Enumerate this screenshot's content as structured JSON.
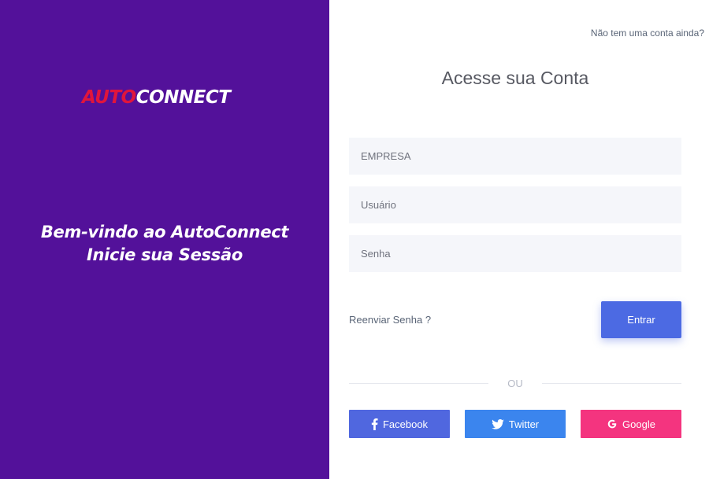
{
  "brand": {
    "logo_part1": "AUTO",
    "logo_part2": "CONNECT"
  },
  "welcome": {
    "line1": "Bem-vindo ao AutoConnect",
    "line2": "Inicie sua Sessão"
  },
  "header": {
    "signup_link": "Não tem uma conta ainda?"
  },
  "form": {
    "title": "Acesse sua Conta",
    "company_placeholder": "EMPRESA",
    "user_placeholder": "Usuário",
    "password_placeholder": "Senha",
    "company_value": "",
    "user_value": "",
    "password_value": "",
    "resend_password": "Reenviar Senha ?",
    "submit_label": "Entrar"
  },
  "divider": {
    "label": "OU"
  },
  "social": {
    "facebook": {
      "label": "Facebook",
      "icon": "facebook-icon",
      "color": "#5067df"
    },
    "twitter": {
      "label": "Twitter",
      "icon": "twitter-icon",
      "color": "#3b85ee"
    },
    "google": {
      "label": "Google",
      "icon": "google-icon",
      "color": "#f4347f"
    }
  },
  "colors": {
    "sidebar_bg": "#53119a",
    "logo_accent": "#e0153c",
    "primary_button": "#4c6ae3",
    "input_bg": "#f5f6fa"
  }
}
